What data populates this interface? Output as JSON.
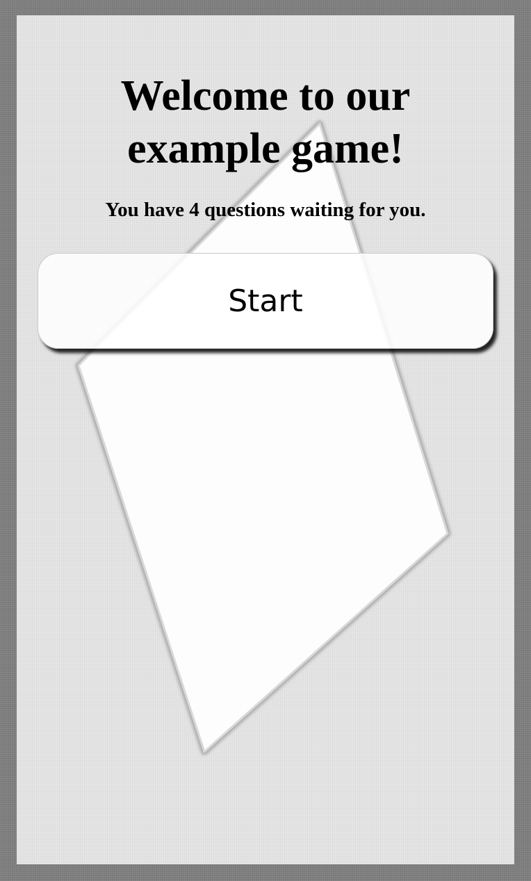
{
  "welcome": {
    "title_line1": "Welcome to our",
    "title_line2": "example game!",
    "subtitle": "You have 4 questions waiting for you."
  },
  "start_button": {
    "label": "Start"
  },
  "colors": {
    "page_background": "#7a7a7a",
    "panel_background": "#e6e6e6",
    "card_fill": "#fdfdfd",
    "text": "#000000"
  }
}
